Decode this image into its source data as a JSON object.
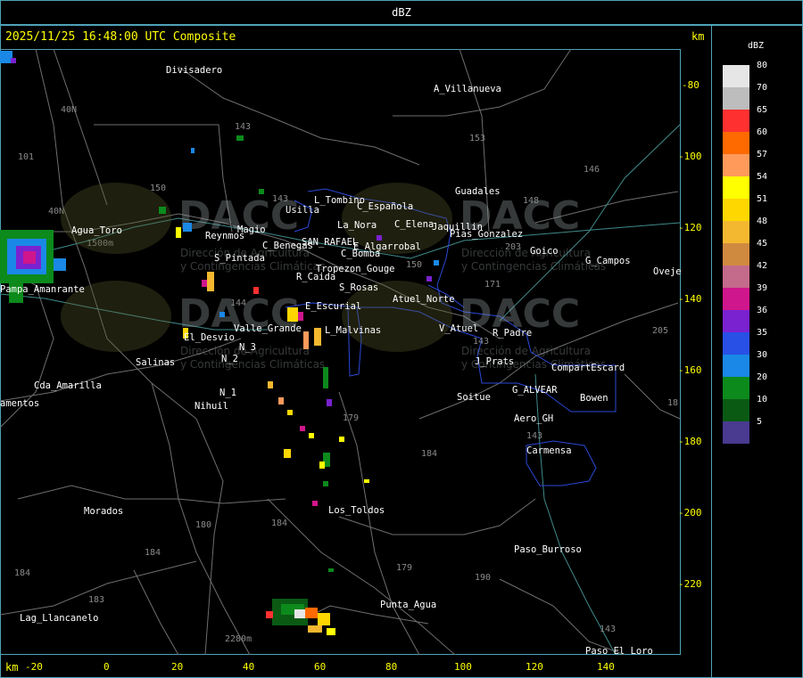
{
  "window_title": "dBZ",
  "header": {
    "timestamp": "2025/11/25 16:48:00 UTC Composite",
    "unit_top": "km",
    "unit_bottom": "km"
  },
  "x_axis_ticks": [
    "-20",
    "0",
    "20",
    "40",
    "60",
    "80",
    "100",
    "120",
    "140"
  ],
  "y_axis_ticks": [
    "-80",
    "-100",
    "-120",
    "-140",
    "-160",
    "-180",
    "-200",
    "-220"
  ],
  "legend": {
    "title": "dBZ",
    "entries": [
      {
        "label": "80",
        "color": "#e6e6e6"
      },
      {
        "label": "70",
        "color": "#bdbdbd"
      },
      {
        "label": "65",
        "color": "#ff3030"
      },
      {
        "label": "60",
        "color": "#ff6a00"
      },
      {
        "label": "57",
        "color": "#ff9a5a"
      },
      {
        "label": "54",
        "color": "#ffff00"
      },
      {
        "label": "51",
        "color": "#ffd700"
      },
      {
        "label": "48",
        "color": "#f4b830"
      },
      {
        "label": "45",
        "color": "#d08a40"
      },
      {
        "label": "42",
        "color": "#c46a8a"
      },
      {
        "label": "39",
        "color": "#d0168c"
      },
      {
        "label": "36",
        "color": "#7a22d0"
      },
      {
        "label": "35",
        "color": "#2850e6"
      },
      {
        "label": "30",
        "color": "#1a88e6"
      },
      {
        "label": "20",
        "color": "#0c8a1c"
      },
      {
        "label": "10",
        "color": "#0a5a14"
      },
      {
        "label": "5",
        "color": "#4a3a90"
      }
    ]
  },
  "places": [
    "Divisadero",
    "A_Villanueva",
    "Usilla",
    "L_Tombino",
    "C_Española",
    "La_Nora",
    "C_Elena",
    "Jaquillin",
    "Pias_Gonzalez",
    "Agua_Toro",
    "Reynmos",
    "S_Pintada",
    "C_Benegas",
    "SAN_RAFAEL",
    "C_Bomba",
    "E_Algarrobal",
    "Pampa_Amanrante",
    "R_Caida",
    "S_Rosas",
    "Tropezon_Gouge",
    "Atuel_Norte",
    "E_Escurial",
    "Valle_Grande",
    "L_Malvinas",
    "El_Desvio",
    "V_Atuel",
    "R_Padre",
    "Salinas",
    "N_2",
    "N_1",
    "Cda_Amarilla",
    "amentos",
    "J_Prats",
    "CompartEscard",
    "G_ALVEAR",
    "Bowen",
    "Soitue",
    "Aero_GH",
    "Nihuil",
    "Carmensa",
    "Morados",
    "Los_Toldos",
    "Paso_Burroso",
    "Punta_Agua",
    "Lag_Llancanelo",
    "Paso_El_Loro",
    "Guadales",
    "Goico",
    "G_Campos",
    "Ovejer",
    "Magio"
  ],
  "routes": [
    "143",
    "153",
    "146",
    "148",
    "101",
    "40N",
    "150",
    "143",
    "203",
    "171",
    "179",
    "184",
    "180",
    "184",
    "179",
    "190",
    "143",
    "143",
    "184",
    "183",
    "205",
    "18",
    "1500m",
    "2280m"
  ],
  "watermark": {
    "brand": "DACC",
    "line1": "Dirección de Agricultura",
    "line2": "y Contingencias Climáticas"
  }
}
